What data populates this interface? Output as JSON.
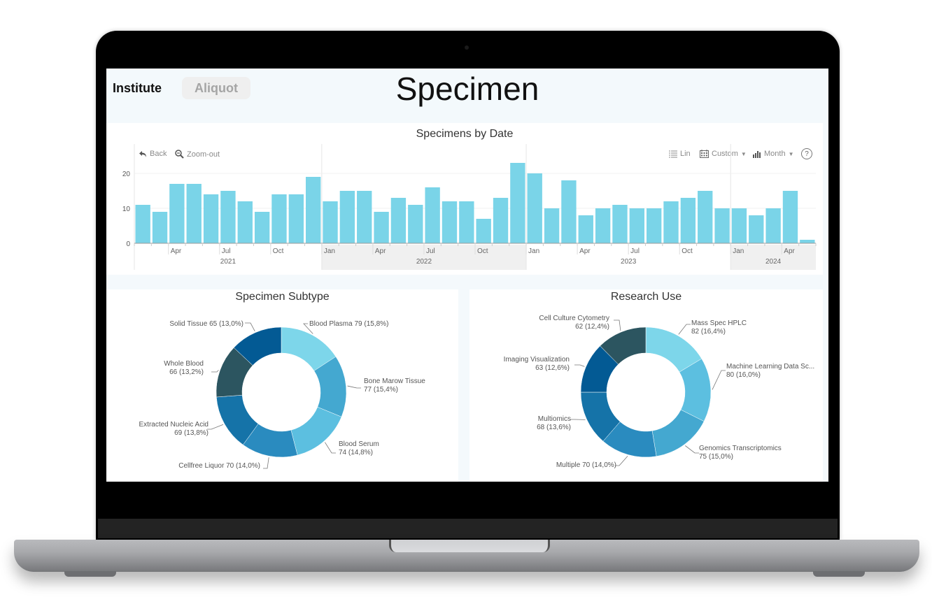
{
  "header": {
    "nav_institute": "Institute",
    "nav_aliquot": "Aliquot",
    "title": "Specimen"
  },
  "toolbar": {
    "back": "Back",
    "zoom_out": "Zoom-out",
    "lin": "Lin",
    "custom": "Custom",
    "month": "Month",
    "help": "?"
  },
  "colors": {
    "bar": "#7ad4e8",
    "band": "#f0f0f0",
    "screen_bg": "#f4f9fc"
  },
  "chart_data": [
    {
      "type": "bar",
      "title": "Specimens by Date",
      "xlabel": "",
      "ylabel": "",
      "ylim": [
        0,
        25
      ],
      "yticks": [
        0,
        10,
        20
      ],
      "grid": true,
      "categories": [
        "2021-02",
        "2021-03",
        "2021-04",
        "2021-05",
        "2021-06",
        "2021-07",
        "2021-08",
        "2021-09",
        "2021-10",
        "2021-11",
        "2021-12",
        "2022-01",
        "2022-02",
        "2022-03",
        "2022-04",
        "2022-05",
        "2022-06",
        "2022-07",
        "2022-08",
        "2022-09",
        "2022-10",
        "2022-11",
        "2022-12",
        "2023-01",
        "2023-02",
        "2023-03",
        "2023-04",
        "2023-05",
        "2023-06",
        "2023-07",
        "2023-08",
        "2023-09",
        "2023-10",
        "2023-11",
        "2023-12",
        "2024-01",
        "2024-02",
        "2024-03",
        "2024-04",
        "2024-05"
      ],
      "values": [
        11,
        9,
        17,
        17,
        14,
        15,
        12,
        9,
        14,
        14,
        19,
        12,
        15,
        15,
        9,
        13,
        11,
        16,
        12,
        12,
        7,
        13,
        23,
        20,
        10,
        18,
        8,
        10,
        11,
        10,
        10,
        12,
        13,
        15,
        10,
        10,
        8,
        10,
        15,
        1
      ],
      "month_labels": [
        {
          "index": 2,
          "label": "Apr"
        },
        {
          "index": 5,
          "label": "Jul"
        },
        {
          "index": 8,
          "label": "Oct"
        },
        {
          "index": 11,
          "label": "Jan"
        },
        {
          "index": 14,
          "label": "Apr"
        },
        {
          "index": 17,
          "label": "Jul"
        },
        {
          "index": 20,
          "label": "Oct"
        },
        {
          "index": 23,
          "label": "Jan"
        },
        {
          "index": 26,
          "label": "Apr"
        },
        {
          "index": 29,
          "label": "Jul"
        },
        {
          "index": 32,
          "label": "Oct"
        },
        {
          "index": 35,
          "label": "Jan"
        },
        {
          "index": 38,
          "label": "Apr"
        }
      ],
      "year_labels": [
        {
          "label": "2021",
          "start": 0,
          "end": 10,
          "shaded": false
        },
        {
          "label": "2022",
          "start": 11,
          "end": 22,
          "shaded": true
        },
        {
          "label": "2023",
          "start": 23,
          "end": 34,
          "shaded": false
        },
        {
          "label": "2024",
          "start": 35,
          "end": 39,
          "shaded": true
        }
      ]
    },
    {
      "type": "pie",
      "title": "Specimen Subtype",
      "slices": [
        {
          "label": "Blood Plasma",
          "value": 79,
          "pct": "15,8%",
          "color": "#7dd6ea"
        },
        {
          "label": "Bone Marow Tissue",
          "value": 77,
          "pct": "15,4%",
          "color": "#44a8d0"
        },
        {
          "label": "Blood Serum",
          "value": 74,
          "pct": "14,8%",
          "color": "#5cbfe0"
        },
        {
          "label": "Cellfree Liquor",
          "value": 70,
          "pct": "14,0%",
          "color": "#2a8bbf"
        },
        {
          "label": "Extracted Nucleic Acid",
          "value": 69,
          "pct": "13,8%",
          "color": "#1573a8"
        },
        {
          "label": "Whole Blood",
          "value": 66,
          "pct": "13,2%",
          "color": "#2c5560"
        },
        {
          "label": "Solid Tissue",
          "value": 65,
          "pct": "13,0%",
          "color": "#035a94"
        }
      ]
    },
    {
      "type": "pie",
      "title": "Research Use",
      "slices": [
        {
          "label": "Mass Spec HPLC",
          "value": 82,
          "pct": "16,4%",
          "color": "#7dd6ea"
        },
        {
          "label": "Machine Learning Data Sc...",
          "value": 80,
          "pct": "16,0%",
          "color": "#5cbfe0"
        },
        {
          "label": "Genomics Transcriptomics",
          "value": 75,
          "pct": "15,0%",
          "color": "#44a8d0"
        },
        {
          "label": "Multiple",
          "value": 70,
          "pct": "14,0%",
          "color": "#2a8bbf"
        },
        {
          "label": "Multiomics",
          "value": 68,
          "pct": "13,6%",
          "color": "#1573a8"
        },
        {
          "label": "Imaging Visualization",
          "value": 63,
          "pct": "12,6%",
          "color": "#035a94"
        },
        {
          "label": "Cell Culture Cytometry",
          "value": 62,
          "pct": "12,4%",
          "color": "#2c5560"
        }
      ]
    }
  ]
}
